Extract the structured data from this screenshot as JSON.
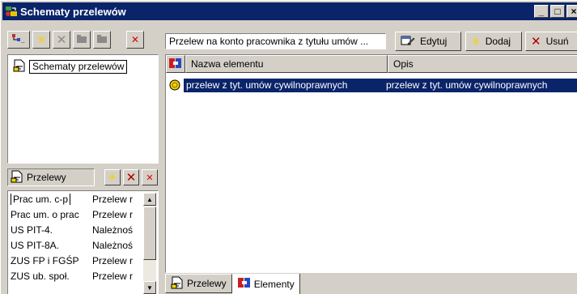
{
  "window": {
    "title": "Schematy przelewów",
    "controls": [
      "_",
      "□",
      "×"
    ]
  },
  "left": {
    "tree": {
      "root_label": "Schematy przelewów"
    },
    "section": {
      "title": "Przelewy"
    },
    "list": [
      {
        "name": "Prac um. c-p",
        "desc": "Przelew r"
      },
      {
        "name": "Prac um. o prac",
        "desc": "Przelew r"
      },
      {
        "name": "US PIT-4.",
        "desc": "Należnoś"
      },
      {
        "name": "US PIT-8A.",
        "desc": "Należnoś"
      },
      {
        "name": "ZUS FP i FGŚP",
        "desc": "Przelew r"
      },
      {
        "name": "ZUS ub. społ.",
        "desc": "Przelew r"
      }
    ]
  },
  "right": {
    "search": {
      "value": "Przelew na konto pracownika z tytułu umów ..."
    },
    "buttons": {
      "edit": "Edytuj",
      "add": "Dodaj",
      "delete": "Usuń"
    },
    "grid": {
      "columns": [
        "Nazwa elementu",
        "Opis"
      ],
      "rows": [
        {
          "name": "przelew z tyt. umów cywilnoprawnych",
          "desc": "przelew z tyt. umów cywilnoprawnych"
        }
      ]
    },
    "tabs": [
      "Przelewy",
      "Elementy"
    ]
  },
  "colors": {
    "titlebar": "#0a246a",
    "face": "#d4d0c8",
    "selection": "#0a246a",
    "accent_red": "#cc0000",
    "accent_yellow": "#f2d200"
  }
}
